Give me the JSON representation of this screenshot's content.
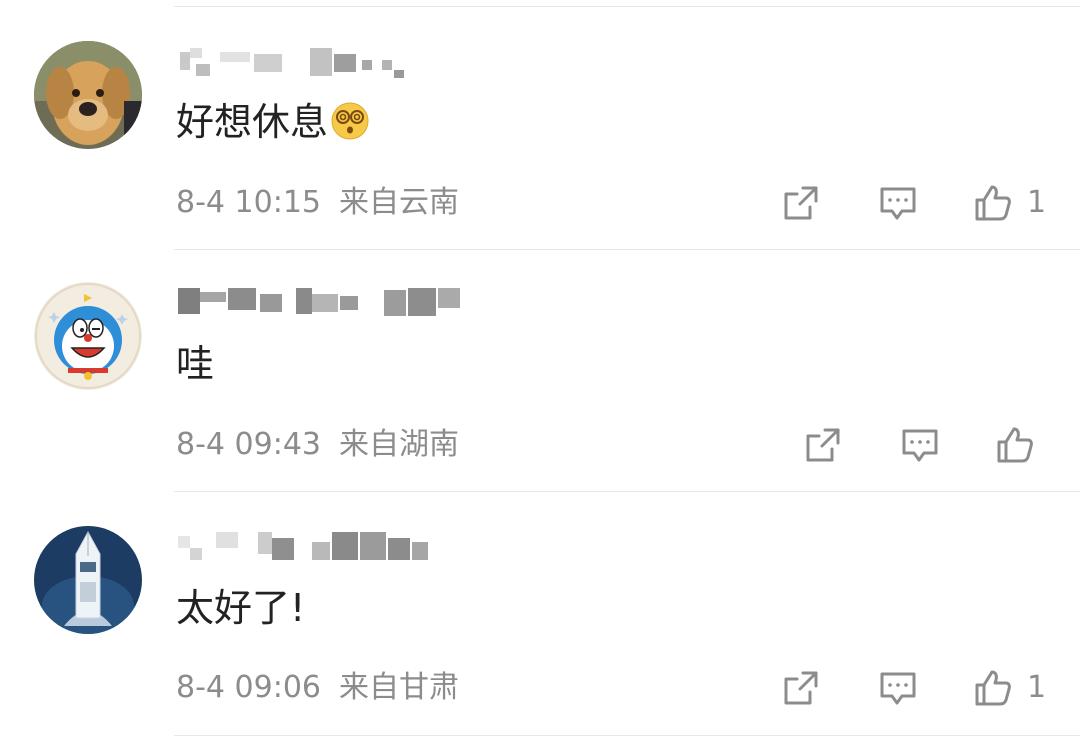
{
  "comments": [
    {
      "content": "好想休息",
      "emoji": "dizzy-face",
      "date": "8-4 10:15",
      "location": "来自云南",
      "like_count": "1",
      "avatar": "puppy"
    },
    {
      "content": "哇",
      "date": "8-4 09:43",
      "location": "来自湖南",
      "like_count": "",
      "avatar": "doraemon"
    },
    {
      "content": "太好了!",
      "date": "8-4 09:06",
      "location": "来自甘肃",
      "like_count": "1",
      "avatar": "boat"
    }
  ],
  "icons": {
    "share": "share-icon",
    "comment": "comment-icon",
    "like": "thumbs-up-icon"
  },
  "colors": {
    "icon_gray": "#8c8c8c",
    "text": "#222222",
    "meta": "#8c8c8c"
  }
}
